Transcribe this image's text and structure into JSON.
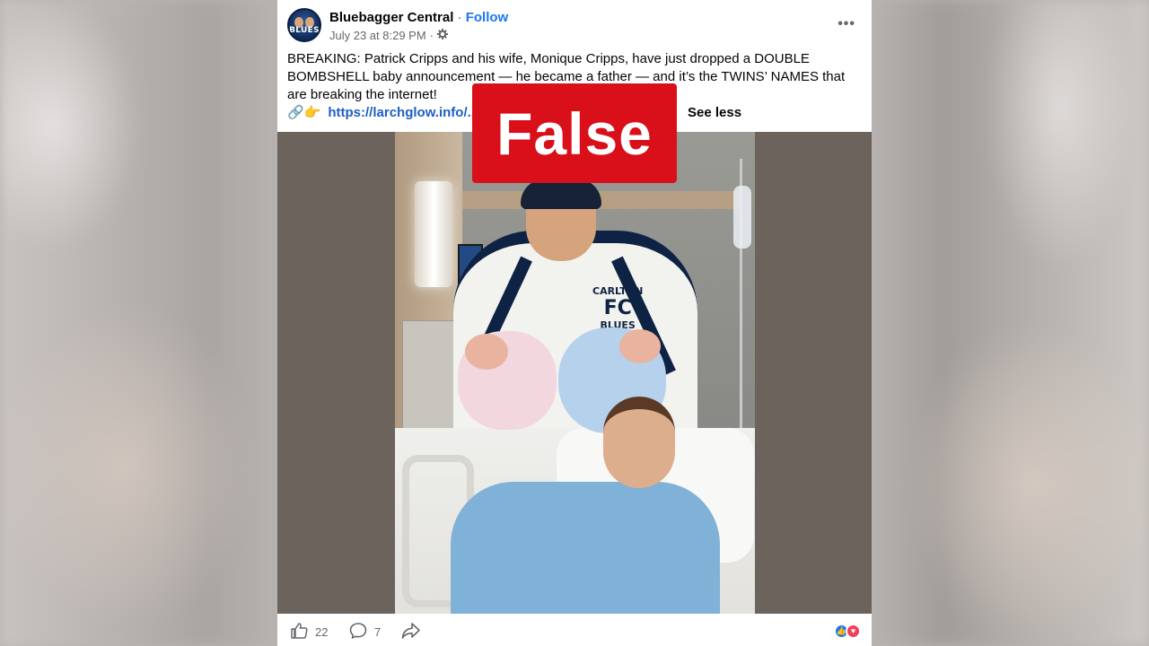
{
  "post": {
    "page_name": "Bluebagger Central",
    "separator": "·",
    "follow_label": "Follow",
    "timestamp": "July 23 at 8:29 PM",
    "timestamp_sep": "·",
    "privacy_icon": "gear-icon",
    "more_label": "•••",
    "avatar_text": "BLUES",
    "caption_text": "BREAKING: Patrick Cripps and his wife, Monique Cripps, have just dropped a DOUBLE BOMBSHELL baby announcement — he became a father — and it’s the TWINS’ NAMES that are breaking the internet!",
    "link_emoji": "🔗👉",
    "link_text": "https://larchglow.info/...",
    "see_less": "See less"
  },
  "photo": {
    "jacket_text_top": "CARLTON",
    "jacket_logo": "FC",
    "jacket_text_bottom": "BLUES"
  },
  "badge": {
    "label": "False",
    "color": "#d90f1a"
  },
  "footer": {
    "like_count": "22",
    "comment_count": "7",
    "like_icon": "thumbs-up-icon",
    "comment_icon": "comment-bubble-icon",
    "share_icon": "share-arrow-icon",
    "reaction_icons": [
      "like-reaction-icon",
      "love-reaction-icon"
    ]
  },
  "colors": {
    "link": "#1d5fc4",
    "follow": "#1877f2",
    "muted": "#65676b"
  }
}
